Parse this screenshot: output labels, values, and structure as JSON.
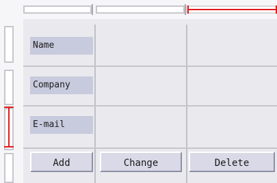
{
  "form": {
    "labels": {
      "name": "Name",
      "company": "Company",
      "email": "E-mail"
    },
    "buttons": {
      "add": "Add",
      "change": "Change",
      "delete": "Delete"
    }
  },
  "colors": {
    "selection_red": "#e21b1b",
    "panel_bg": "#e9e9ee",
    "label_bg": "#c8cadd",
    "button_bg": "#d9d9e7"
  }
}
